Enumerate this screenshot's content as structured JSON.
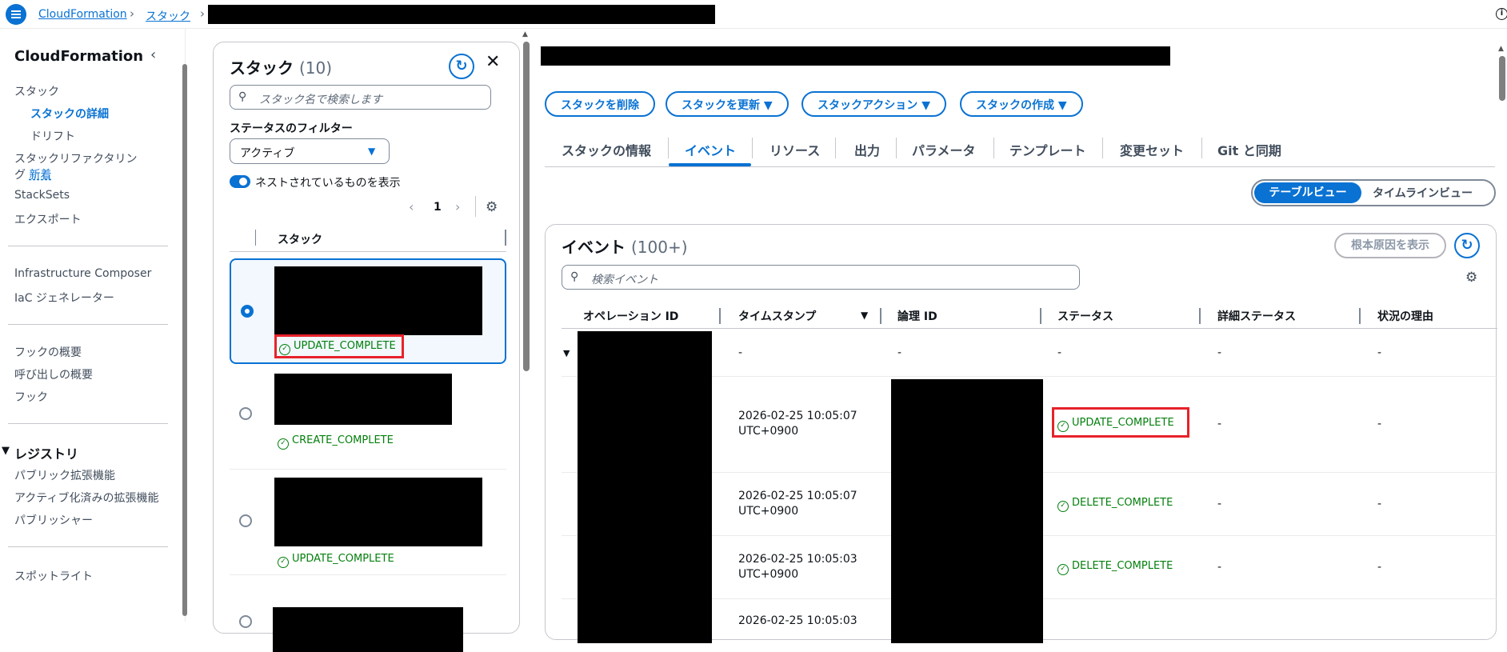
{
  "breadcrumb": {
    "root": "CloudFormation",
    "stacks": "スタック"
  },
  "nav": {
    "title": "CloudFormation",
    "items": {
      "stacks": "スタック",
      "stack_details": "スタックの詳細",
      "drift": "ドリフト",
      "refactoring_line1": "スタックリファクタリン",
      "refactoring_line2": "グ",
      "new_badge": "新着",
      "stacksets": "StackSets",
      "exports": "エクスポート",
      "infra_composer": "Infrastructure Composer",
      "iac_generator": "IaC ジェネレーター",
      "hooks_overview": "フックの概要",
      "invocations_overview": "呼び出しの概要",
      "hooks": "フック",
      "registry": "レジストリ",
      "public_extensions": "パブリック拡張機能",
      "activated_extensions": "アクティブ化済みの拡張機能",
      "publisher": "パブリッシャー",
      "spotlight": "スポットライト"
    }
  },
  "stack_panel": {
    "title": "スタック",
    "count": "(10)",
    "search_placeholder": "スタック名で検索します",
    "filter_label": "ステータスのフィルター",
    "filter_value": "アクティブ",
    "nested_label": "ネストされているものを表示",
    "page": "1",
    "column": "スタック",
    "stacks": [
      {
        "status": "UPDATE_COMPLETE",
        "selected": true
      },
      {
        "status": "CREATE_COMPLETE",
        "selected": false
      },
      {
        "status": "UPDATE_COMPLETE",
        "selected": false
      },
      {
        "status": "",
        "selected": false
      }
    ]
  },
  "actions": {
    "delete": "スタックを削除",
    "update": "スタックを更新",
    "stack_actions": "スタックアクション",
    "create": "スタックの作成"
  },
  "tabs": [
    "スタックの情報",
    "イベント",
    "リソース",
    "出力",
    "パラメータ",
    "テンプレート",
    "変更セット",
    "Git と同期"
  ],
  "active_tab": "イベント",
  "view_toggle": {
    "table": "テーブルビュー",
    "timeline": "タイムラインビュー"
  },
  "events": {
    "title": "イベント",
    "count": "(100+)",
    "root_cause": "根本原因を表示",
    "search_placeholder": "検索イベント",
    "columns": [
      "オペレーション ID",
      "タイムスタンプ",
      "論理 ID",
      "ステータス",
      "詳細ステータス",
      "状況の理由"
    ],
    "rows": [
      {
        "timestamp": "-",
        "timestamp2": "",
        "logical": "-",
        "status": "-",
        "detail": "-",
        "reason": "-"
      },
      {
        "timestamp": "2026-02-25 10:05:07",
        "timestamp2": "UTC+0900",
        "status": "UPDATE_COMPLETE",
        "detail": "-",
        "reason": "-"
      },
      {
        "timestamp": "2026-02-25 10:05:07",
        "timestamp2": "UTC+0900",
        "status": "DELETE_COMPLETE",
        "detail": "-",
        "reason": "-"
      },
      {
        "timestamp": "2026-02-25 10:05:03",
        "timestamp2": "UTC+0900",
        "status": "DELETE_COMPLETE",
        "detail": "-",
        "reason": "-"
      },
      {
        "timestamp": "2026-02-25 10:05:03",
        "timestamp2": "",
        "status": "",
        "detail": "",
        "reason": ""
      }
    ]
  },
  "colors": {
    "accent": "#0972d3",
    "success": "#037f0c",
    "highlight": "#e8222a"
  }
}
